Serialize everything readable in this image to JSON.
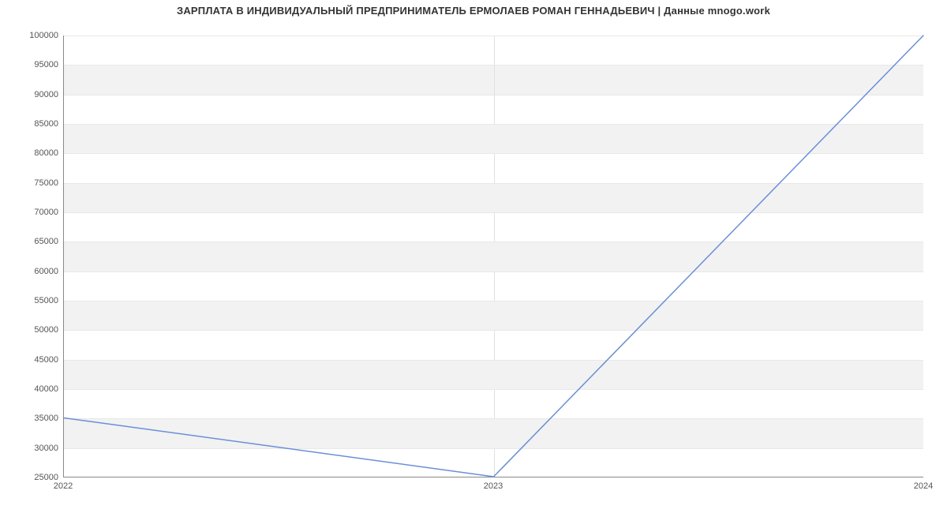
{
  "chart_data": {
    "type": "line",
    "title": "ЗАРПЛАТА В ИНДИВИДУАЛЬНЫЙ ПРЕДПРИНИМАТЕЛЬ ЕРМОЛАЕВ РОМАН ГЕННАДЬЕВИЧ | Данные mnogo.work",
    "x": [
      2022,
      2023,
      2024
    ],
    "values": [
      35000,
      25000,
      100000
    ],
    "x_ticks": [
      2022,
      2023,
      2024
    ],
    "y_ticks": [
      25000,
      30000,
      35000,
      40000,
      45000,
      50000,
      55000,
      60000,
      65000,
      70000,
      75000,
      80000,
      85000,
      90000,
      95000,
      100000
    ],
    "xlim": [
      2022,
      2024
    ],
    "ylim": [
      25000,
      100000
    ],
    "xlabel": "",
    "ylabel": "",
    "grid": true,
    "line_color": "#6a8fd8"
  }
}
